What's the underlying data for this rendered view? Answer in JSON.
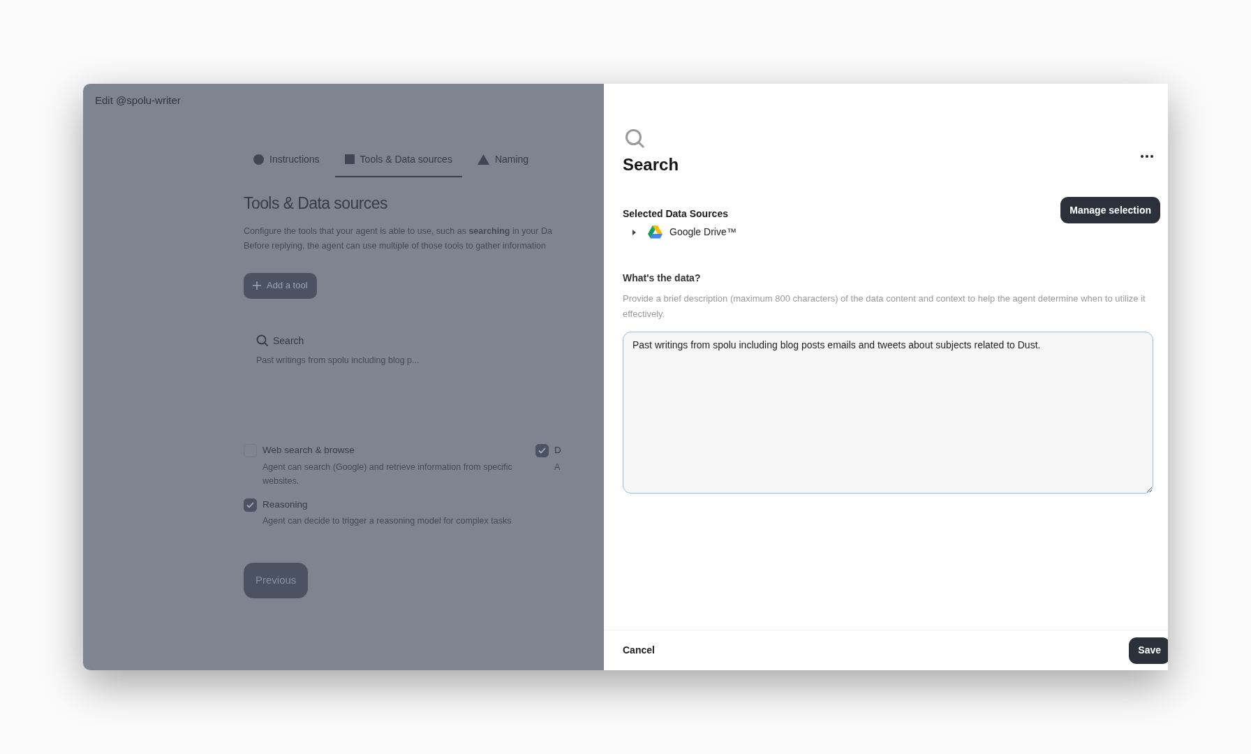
{
  "editor": {
    "title": "Edit @spolu-writer",
    "tabs": [
      {
        "label": "Instructions",
        "selected": false
      },
      {
        "label": "Tools & Data sources",
        "selected": true
      },
      {
        "label": "Naming",
        "selected": false
      }
    ],
    "heading": "Tools & Data sources",
    "description_lines": [
      "Configure the tools that your agent is able to use, such as **searching** in your Da",
      "Before replying, the agent can use multiple of those tools to gather information"
    ],
    "add_button": "Add a tool",
    "tool_card": {
      "title": "Search",
      "description": "Past writings from spolu including blog p..."
    },
    "options": [
      {
        "title": "Web search & browse",
        "description": "Agent can search (Google) and retrieve information from specific websites.",
        "checked": false
      },
      {
        "title": "D",
        "description": "A",
        "checked": true
      },
      {
        "title": "Reasoning",
        "description": "Agent can decide to trigger a reasoning model for complex tasks",
        "checked": true
      }
    ],
    "previous_button": "Previous"
  },
  "panel": {
    "title": "Search",
    "sources_label": "Selected Data Sources",
    "manage_button": "Manage selection",
    "sources": [
      {
        "name": "Google Drive™",
        "expanded": false
      }
    ],
    "data_label": "What's the data?",
    "data_help": "Provide a brief description (maximum 800 characters) of the data content and context to help the agent determine when to utilize it effectively.",
    "data_value": "Past writings from spolu including blog posts emails and tweets about subjects related to Dust.",
    "cancel_button": "Cancel",
    "save_button": "Save"
  }
}
